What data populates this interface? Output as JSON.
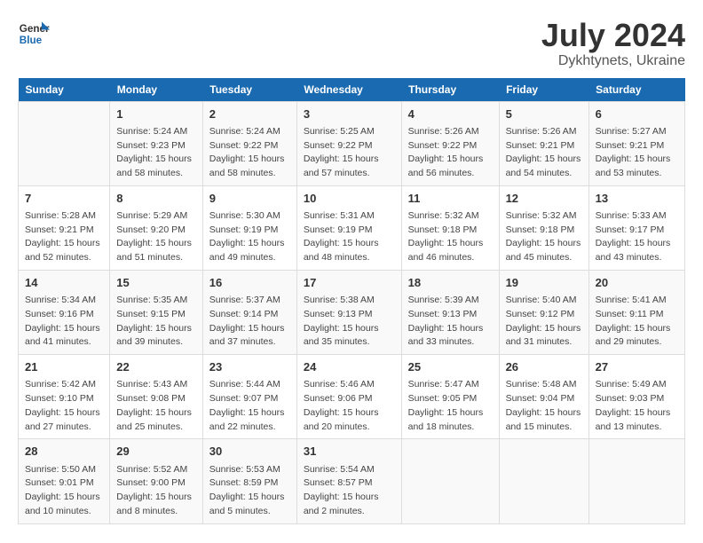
{
  "logo": {
    "line1": "General",
    "line2": "Blue"
  },
  "title": "July 2024",
  "subtitle": "Dykhtynets, Ukraine",
  "days_of_week": [
    "Sunday",
    "Monday",
    "Tuesday",
    "Wednesday",
    "Thursday",
    "Friday",
    "Saturday"
  ],
  "weeks": [
    [
      {
        "day": "",
        "sunrise": "",
        "sunset": "",
        "daylight": ""
      },
      {
        "day": "1",
        "sunrise": "Sunrise: 5:24 AM",
        "sunset": "Sunset: 9:23 PM",
        "daylight": "Daylight: 15 hours and 58 minutes."
      },
      {
        "day": "2",
        "sunrise": "Sunrise: 5:24 AM",
        "sunset": "Sunset: 9:22 PM",
        "daylight": "Daylight: 15 hours and 58 minutes."
      },
      {
        "day": "3",
        "sunrise": "Sunrise: 5:25 AM",
        "sunset": "Sunset: 9:22 PM",
        "daylight": "Daylight: 15 hours and 57 minutes."
      },
      {
        "day": "4",
        "sunrise": "Sunrise: 5:26 AM",
        "sunset": "Sunset: 9:22 PM",
        "daylight": "Daylight: 15 hours and 56 minutes."
      },
      {
        "day": "5",
        "sunrise": "Sunrise: 5:26 AM",
        "sunset": "Sunset: 9:21 PM",
        "daylight": "Daylight: 15 hours and 54 minutes."
      },
      {
        "day": "6",
        "sunrise": "Sunrise: 5:27 AM",
        "sunset": "Sunset: 9:21 PM",
        "daylight": "Daylight: 15 hours and 53 minutes."
      }
    ],
    [
      {
        "day": "7",
        "sunrise": "Sunrise: 5:28 AM",
        "sunset": "Sunset: 9:21 PM",
        "daylight": "Daylight: 15 hours and 52 minutes."
      },
      {
        "day": "8",
        "sunrise": "Sunrise: 5:29 AM",
        "sunset": "Sunset: 9:20 PM",
        "daylight": "Daylight: 15 hours and 51 minutes."
      },
      {
        "day": "9",
        "sunrise": "Sunrise: 5:30 AM",
        "sunset": "Sunset: 9:19 PM",
        "daylight": "Daylight: 15 hours and 49 minutes."
      },
      {
        "day": "10",
        "sunrise": "Sunrise: 5:31 AM",
        "sunset": "Sunset: 9:19 PM",
        "daylight": "Daylight: 15 hours and 48 minutes."
      },
      {
        "day": "11",
        "sunrise": "Sunrise: 5:32 AM",
        "sunset": "Sunset: 9:18 PM",
        "daylight": "Daylight: 15 hours and 46 minutes."
      },
      {
        "day": "12",
        "sunrise": "Sunrise: 5:32 AM",
        "sunset": "Sunset: 9:18 PM",
        "daylight": "Daylight: 15 hours and 45 minutes."
      },
      {
        "day": "13",
        "sunrise": "Sunrise: 5:33 AM",
        "sunset": "Sunset: 9:17 PM",
        "daylight": "Daylight: 15 hours and 43 minutes."
      }
    ],
    [
      {
        "day": "14",
        "sunrise": "Sunrise: 5:34 AM",
        "sunset": "Sunset: 9:16 PM",
        "daylight": "Daylight: 15 hours and 41 minutes."
      },
      {
        "day": "15",
        "sunrise": "Sunrise: 5:35 AM",
        "sunset": "Sunset: 9:15 PM",
        "daylight": "Daylight: 15 hours and 39 minutes."
      },
      {
        "day": "16",
        "sunrise": "Sunrise: 5:37 AM",
        "sunset": "Sunset: 9:14 PM",
        "daylight": "Daylight: 15 hours and 37 minutes."
      },
      {
        "day": "17",
        "sunrise": "Sunrise: 5:38 AM",
        "sunset": "Sunset: 9:13 PM",
        "daylight": "Daylight: 15 hours and 35 minutes."
      },
      {
        "day": "18",
        "sunrise": "Sunrise: 5:39 AM",
        "sunset": "Sunset: 9:13 PM",
        "daylight": "Daylight: 15 hours and 33 minutes."
      },
      {
        "day": "19",
        "sunrise": "Sunrise: 5:40 AM",
        "sunset": "Sunset: 9:12 PM",
        "daylight": "Daylight: 15 hours and 31 minutes."
      },
      {
        "day": "20",
        "sunrise": "Sunrise: 5:41 AM",
        "sunset": "Sunset: 9:11 PM",
        "daylight": "Daylight: 15 hours and 29 minutes."
      }
    ],
    [
      {
        "day": "21",
        "sunrise": "Sunrise: 5:42 AM",
        "sunset": "Sunset: 9:10 PM",
        "daylight": "Daylight: 15 hours and 27 minutes."
      },
      {
        "day": "22",
        "sunrise": "Sunrise: 5:43 AM",
        "sunset": "Sunset: 9:08 PM",
        "daylight": "Daylight: 15 hours and 25 minutes."
      },
      {
        "day": "23",
        "sunrise": "Sunrise: 5:44 AM",
        "sunset": "Sunset: 9:07 PM",
        "daylight": "Daylight: 15 hours and 22 minutes."
      },
      {
        "day": "24",
        "sunrise": "Sunrise: 5:46 AM",
        "sunset": "Sunset: 9:06 PM",
        "daylight": "Daylight: 15 hours and 20 minutes."
      },
      {
        "day": "25",
        "sunrise": "Sunrise: 5:47 AM",
        "sunset": "Sunset: 9:05 PM",
        "daylight": "Daylight: 15 hours and 18 minutes."
      },
      {
        "day": "26",
        "sunrise": "Sunrise: 5:48 AM",
        "sunset": "Sunset: 9:04 PM",
        "daylight": "Daylight: 15 hours and 15 minutes."
      },
      {
        "day": "27",
        "sunrise": "Sunrise: 5:49 AM",
        "sunset": "Sunset: 9:03 PM",
        "daylight": "Daylight: 15 hours and 13 minutes."
      }
    ],
    [
      {
        "day": "28",
        "sunrise": "Sunrise: 5:50 AM",
        "sunset": "Sunset: 9:01 PM",
        "daylight": "Daylight: 15 hours and 10 minutes."
      },
      {
        "day": "29",
        "sunrise": "Sunrise: 5:52 AM",
        "sunset": "Sunset: 9:00 PM",
        "daylight": "Daylight: 15 hours and 8 minutes."
      },
      {
        "day": "30",
        "sunrise": "Sunrise: 5:53 AM",
        "sunset": "Sunset: 8:59 PM",
        "daylight": "Daylight: 15 hours and 5 minutes."
      },
      {
        "day": "31",
        "sunrise": "Sunrise: 5:54 AM",
        "sunset": "Sunset: 8:57 PM",
        "daylight": "Daylight: 15 hours and 2 minutes."
      },
      {
        "day": "",
        "sunrise": "",
        "sunset": "",
        "daylight": ""
      },
      {
        "day": "",
        "sunrise": "",
        "sunset": "",
        "daylight": ""
      },
      {
        "day": "",
        "sunrise": "",
        "sunset": "",
        "daylight": ""
      }
    ]
  ]
}
